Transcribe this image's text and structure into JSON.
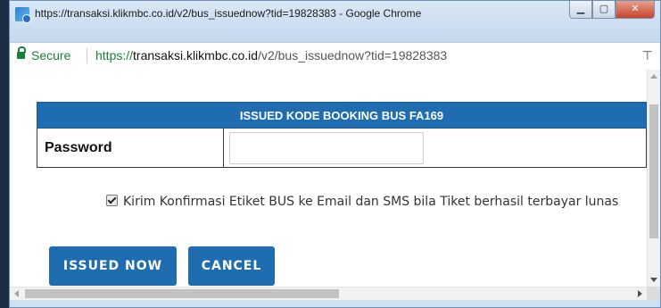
{
  "window": {
    "title": "https://transaksi.klikmbc.co.id/v2/bus_issuednow?tid=19828383 - Google Chrome",
    "minimize_glyph": "▁",
    "maximize_glyph": "▢",
    "close_glyph": "✕"
  },
  "addressbar": {
    "secure_label": "Secure",
    "url_scheme": "https://",
    "url_host": "transaksi.klikmbc.co.id",
    "url_path": "/v2/bus_issuednow?tid=19828383",
    "pin_glyph": "⊤"
  },
  "form": {
    "header": "ISSUED KODE BOOKING BUS FA169",
    "password_label": "Password",
    "password_value": "",
    "confirm_checked": true,
    "confirm_text": "Kirim Konfirmasi Etiket BUS ke Email dan SMS bila Tiket berhasil terbayar lunas",
    "issue_button": "ISSUED NOW",
    "cancel_button": "CANCEL"
  },
  "colors": {
    "primary": "#1f6db0",
    "secure_green": "#188038"
  }
}
